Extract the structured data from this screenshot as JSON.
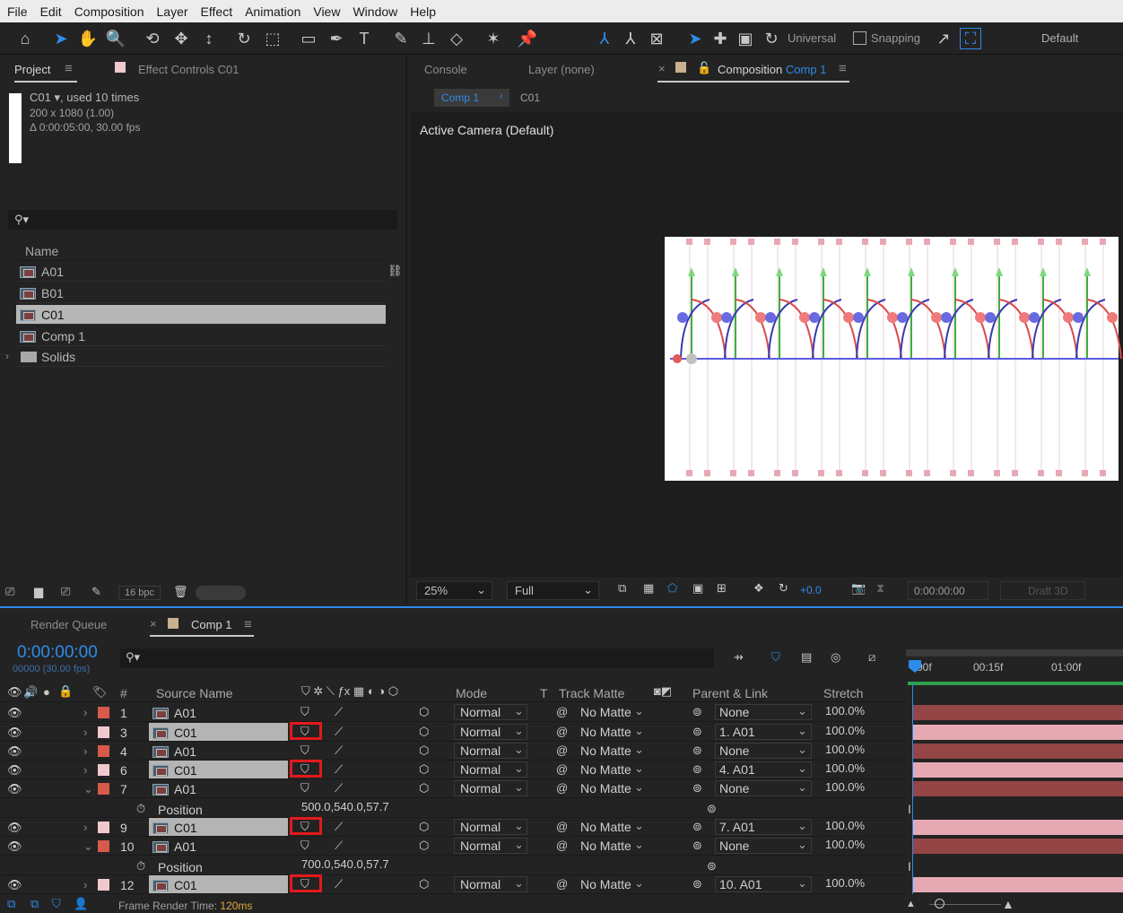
{
  "menu": [
    "File",
    "Edit",
    "Composition",
    "Layer",
    "Effect",
    "Animation",
    "View",
    "Window",
    "Help"
  ],
  "toolbar": {
    "universal": "Universal",
    "snapping": "Snapping",
    "workspace": "Default"
  },
  "project": {
    "tab_label": "Project",
    "effect_controls_tab": "Effect Controls C01",
    "item_name": "C01",
    "used": ", used 10 times",
    "dims": "200 x 1080 (1.00)",
    "duration": "Δ 0:00:05:00, 30.00 fps",
    "name_header": "Name",
    "items": [
      {
        "name": "A01"
      },
      {
        "name": "B01"
      },
      {
        "name": "C01"
      },
      {
        "name": "Comp 1"
      },
      {
        "name": "Solids"
      }
    ],
    "bpc": "16 bpc"
  },
  "viewer": {
    "console_tab": "Console",
    "layer_tab": "Layer (none)",
    "comp_tab_prefix": "Composition",
    "comp_tab_name": "Comp 1",
    "breadcrumb_comp": "Comp 1",
    "breadcrumb_c01": "C01",
    "camera": "Active Camera (Default)",
    "zoom": "25%",
    "resolution": "Full",
    "exposure": "+0.0",
    "timecode": "0:00:00:00",
    "draft3d": "Draft 3D"
  },
  "timeline": {
    "render_queue_tab": "Render Queue",
    "comp_tab": "Comp 1",
    "current_time": "0:00:00:00",
    "frame_info": "00000 (30.00 fps)",
    "headers": {
      "num": "#",
      "source": "Source Name",
      "mode": "Mode",
      "t": "T",
      "matte": "Track Matte",
      "parent": "Parent & Link",
      "stretch": "Stretch"
    },
    "ruler": [
      "00f",
      "00:15f",
      "01:00f"
    ],
    "rows": [
      {
        "num": "1",
        "name": "A01",
        "label_color": "#d85a4a",
        "mode": "Normal",
        "matte": "No Matte",
        "parent": "None",
        "stretch": "100.0%",
        "selected": false,
        "expanded": false,
        "highlight": false,
        "bar": "dark"
      },
      {
        "num": "3",
        "name": "C01",
        "label_color": "#f0c9cf",
        "mode": "Normal",
        "matte": "No Matte",
        "parent": "1. A01",
        "stretch": "100.0%",
        "selected": true,
        "expanded": false,
        "highlight": true,
        "bar": "light"
      },
      {
        "num": "4",
        "name": "A01",
        "label_color": "#d85a4a",
        "mode": "Normal",
        "matte": "No Matte",
        "parent": "None",
        "stretch": "100.0%",
        "selected": false,
        "expanded": false,
        "highlight": false,
        "bar": "dark"
      },
      {
        "num": "6",
        "name": "C01",
        "label_color": "#f0c9cf",
        "mode": "Normal",
        "matte": "No Matte",
        "parent": "4. A01",
        "stretch": "100.0%",
        "selected": true,
        "expanded": false,
        "highlight": true,
        "bar": "light"
      },
      {
        "num": "7",
        "name": "A01",
        "label_color": "#d85a4a",
        "mode": "Normal",
        "matte": "No Matte",
        "parent": "None",
        "stretch": "100.0%",
        "selected": false,
        "expanded": true,
        "highlight": false,
        "bar": "dark"
      },
      {
        "prop": "Position",
        "value": "500.0,540.0,57.7"
      },
      {
        "num": "9",
        "name": "C01",
        "label_color": "#f0c9cf",
        "mode": "Normal",
        "matte": "No Matte",
        "parent": "7. A01",
        "stretch": "100.0%",
        "selected": true,
        "expanded": false,
        "highlight": true,
        "bar": "light"
      },
      {
        "num": "10",
        "name": "A01",
        "label_color": "#d85a4a",
        "mode": "Normal",
        "matte": "No Matte",
        "parent": "None",
        "stretch": "100.0%",
        "selected": false,
        "expanded": true,
        "highlight": false,
        "bar": "dark"
      },
      {
        "prop": "Position",
        "value": "700.0,540.0,57.7"
      },
      {
        "num": "12",
        "name": "C01",
        "label_color": "#f0c9cf",
        "mode": "Normal",
        "matte": "No Matte",
        "parent": "10. A01",
        "stretch": "100.0%",
        "selected": true,
        "expanded": false,
        "highlight": true,
        "bar": "light"
      }
    ],
    "render_time_label": "Frame Render Time:",
    "render_time": "120ms"
  },
  "colors": {
    "accent": "#2d8ceb",
    "highlight_box": "#e3191b",
    "label_red": "#d85a4a",
    "label_pink": "#f0c9cf"
  }
}
